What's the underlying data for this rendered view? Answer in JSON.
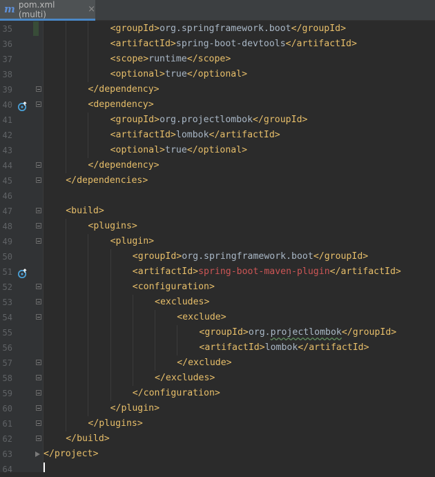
{
  "tab": {
    "icon": "m",
    "label": "pom.xml (multi)",
    "close": "×"
  },
  "colors": {
    "background": "#2b2b2b",
    "gutter": "#313335",
    "tag": "#e8bf6a",
    "text": "#a9b7c6",
    "error_text": "#cc5555",
    "line_number": "#606366",
    "tab_underline": "#4a88c7"
  },
  "lines": [
    {
      "n": "35",
      "indent": 3,
      "open": "<groupId>",
      "text": "org.springframework.boot",
      "close": "</groupId>"
    },
    {
      "n": "36",
      "indent": 3,
      "open": "<artifactId>",
      "text": "spring-boot-devtools",
      "close": "</artifactId>"
    },
    {
      "n": "37",
      "indent": 3,
      "open": "<scope>",
      "text": "runtime",
      "close": "</scope>"
    },
    {
      "n": "38",
      "indent": 3,
      "open": "<optional>",
      "text": "true",
      "close": "</optional>"
    },
    {
      "n": "39",
      "indent": 2,
      "open": "</dependency>",
      "text": "",
      "close": "",
      "fold": "box"
    },
    {
      "n": "40",
      "indent": 2,
      "open": "<dependency>",
      "text": "",
      "close": "",
      "fold": "box",
      "icon": "maven-dependency-icon"
    },
    {
      "n": "41",
      "indent": 3,
      "open": "<groupId>",
      "text": "org.projectlombok",
      "close": "</groupId>"
    },
    {
      "n": "42",
      "indent": 3,
      "open": "<artifactId>",
      "text": "lombok",
      "close": "</artifactId>"
    },
    {
      "n": "43",
      "indent": 3,
      "open": "<optional>",
      "text": "true",
      "close": "</optional>"
    },
    {
      "n": "44",
      "indent": 2,
      "open": "</dependency>",
      "text": "",
      "close": "",
      "fold": "box"
    },
    {
      "n": "45",
      "indent": 1,
      "open": "</dependencies>",
      "text": "",
      "close": "",
      "fold": "box"
    },
    {
      "n": "46",
      "indent": 0,
      "open": "",
      "text": "",
      "close": ""
    },
    {
      "n": "47",
      "indent": 1,
      "open": "<build>",
      "text": "",
      "close": "",
      "fold": "box"
    },
    {
      "n": "48",
      "indent": 2,
      "open": "<plugins>",
      "text": "",
      "close": "",
      "fold": "box"
    },
    {
      "n": "49",
      "indent": 3,
      "open": "<plugin>",
      "text": "",
      "close": "",
      "fold": "box"
    },
    {
      "n": "50",
      "indent": 4,
      "open": "<groupId>",
      "text": "org.springframework.boot",
      "close": "</groupId>"
    },
    {
      "n": "51",
      "indent": 4,
      "open": "<artifactId>",
      "text": "spring-boot-maven-plugin",
      "close": "</artifactId>",
      "error": true,
      "icon": "maven-plugin-icon"
    },
    {
      "n": "52",
      "indent": 4,
      "open": "<configuration>",
      "text": "",
      "close": "",
      "fold": "box"
    },
    {
      "n": "53",
      "indent": 5,
      "open": "<excludes>",
      "text": "",
      "close": "",
      "fold": "box"
    },
    {
      "n": "54",
      "indent": 6,
      "open": "<exclude>",
      "text": "",
      "close": "",
      "fold": "box"
    },
    {
      "n": "55",
      "indent": 7,
      "open": "<groupId>",
      "text": "org.projectlombok",
      "close": "</groupId>",
      "wavy": true
    },
    {
      "n": "56",
      "indent": 7,
      "open": "<artifactId>",
      "text": "lombok",
      "close": "</artifactId>"
    },
    {
      "n": "57",
      "indent": 6,
      "open": "</exclude>",
      "text": "",
      "close": "",
      "fold": "box"
    },
    {
      "n": "58",
      "indent": 5,
      "open": "</excludes>",
      "text": "",
      "close": "",
      "fold": "box"
    },
    {
      "n": "59",
      "indent": 4,
      "open": "</configuration>",
      "text": "",
      "close": "",
      "fold": "box"
    },
    {
      "n": "60",
      "indent": 3,
      "open": "</plugin>",
      "text": "",
      "close": "",
      "fold": "box"
    },
    {
      "n": "61",
      "indent": 2,
      "open": "</plugins>",
      "text": "",
      "close": "",
      "fold": "box"
    },
    {
      "n": "62",
      "indent": 1,
      "open": "</build>",
      "text": "",
      "close": "",
      "fold": "box"
    },
    {
      "n": "63",
      "indent": 0,
      "open": "</project>",
      "text": "",
      "close": "",
      "fold": "end"
    },
    {
      "n": "64",
      "indent": 0,
      "open": "",
      "text": "",
      "close": ""
    }
  ]
}
